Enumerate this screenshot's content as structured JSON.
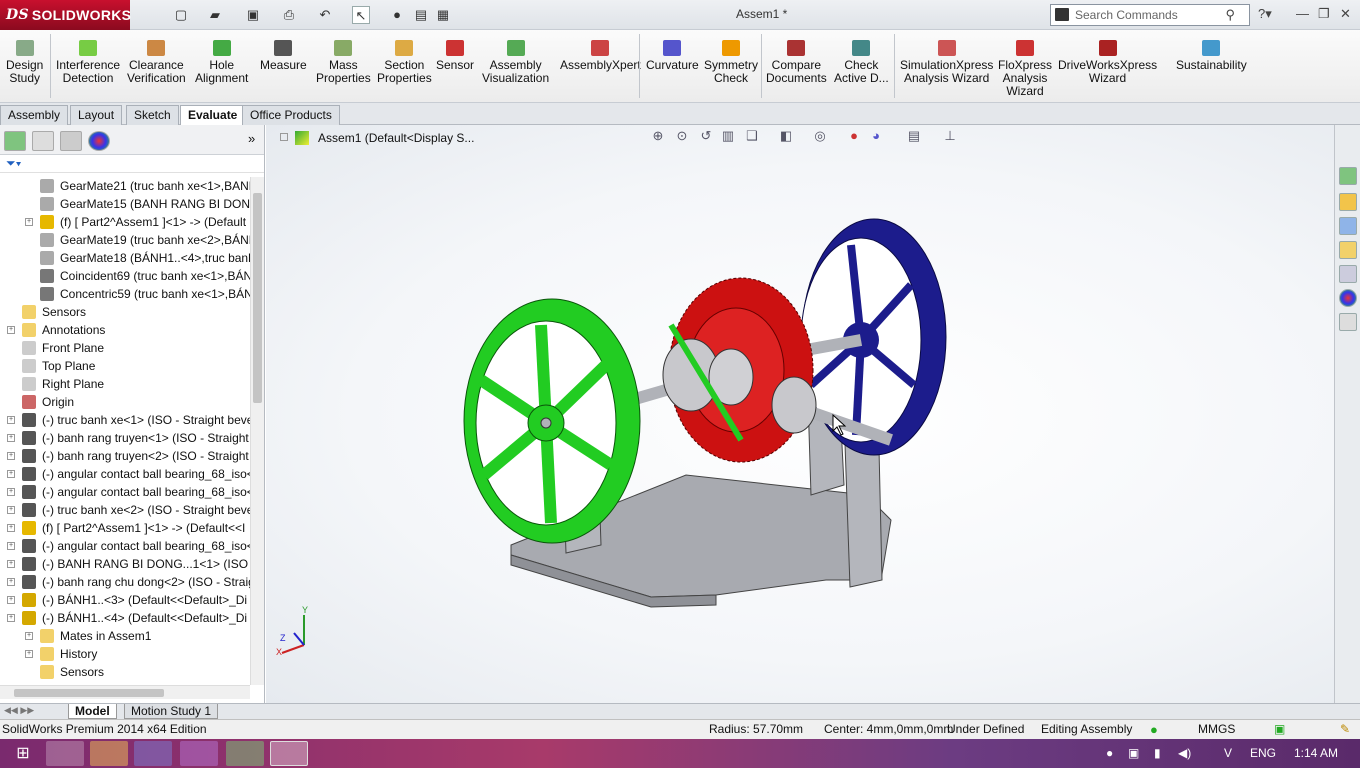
{
  "app": {
    "logo_text": "SOLIDWORKS",
    "window_title": "Assem1 *"
  },
  "search": {
    "placeholder": "Search Commands"
  },
  "ribbon": {
    "buttons": [
      {
        "label": "Design\nStudy",
        "icon": "design-study-icon"
      },
      {
        "label": "Interference\nDetection",
        "icon": "interference-icon"
      },
      {
        "label": "Clearance\nVerification",
        "icon": "clearance-icon"
      },
      {
        "label": "Hole\nAlignment",
        "icon": "hole-alignment-icon"
      },
      {
        "label": "Measure",
        "icon": "measure-icon"
      },
      {
        "label": "Mass\nProperties",
        "icon": "mass-properties-icon"
      },
      {
        "label": "Section\nProperties",
        "icon": "section-properties-icon"
      },
      {
        "label": "Sensor",
        "icon": "sensor-icon"
      },
      {
        "label": "Assembly\nVisualization",
        "icon": "assembly-visualization-icon"
      },
      {
        "label": "AssemblyXpert",
        "icon": "assemblyxpert-icon"
      },
      {
        "label": "Curvature",
        "icon": "curvature-icon"
      },
      {
        "label": "Symmetry\nCheck",
        "icon": "symmetry-icon"
      },
      {
        "label": "Compare\nDocuments",
        "icon": "compare-icon"
      },
      {
        "label": "Check\nActive D...",
        "icon": "check-active-icon"
      },
      {
        "label": "SimulationXpress\nAnalysis Wizard",
        "icon": "simulationxpress-icon"
      },
      {
        "label": "FloXpress\nAnalysis\nWizard",
        "icon": "floxpress-icon"
      },
      {
        "label": "DriveWorksXpress\nWizard",
        "icon": "driveworks-icon"
      },
      {
        "label": "Sustainability",
        "icon": "sustainability-icon"
      }
    ]
  },
  "tabs": [
    "Assembly",
    "Layout",
    "Sketch",
    "Evaluate",
    "Office Products"
  ],
  "active_tab": "Evaluate",
  "tree": {
    "items": [
      {
        "label": "GearMate21 (truc banh xe<1>,BANH",
        "indent": 2,
        "icon": "gear-mate-icon"
      },
      {
        "label": "GearMate15 (BANH RANG BI DONG",
        "indent": 2,
        "icon": "gear-mate-icon"
      },
      {
        "label": "(f) [ Part2^Assem1 ]<1> -> (Default",
        "indent": 2,
        "icon": "part-icon",
        "expand": true
      },
      {
        "label": "GearMate19 (truc banh xe<2>,BÁNH",
        "indent": 2,
        "icon": "gear-mate-icon"
      },
      {
        "label": "GearMate18 (BÁNH1..<4>,truc banh",
        "indent": 2,
        "icon": "gear-mate-icon"
      },
      {
        "label": "Coincident69 (truc banh xe<1>,BÁN",
        "indent": 2,
        "icon": "coincident-icon"
      },
      {
        "label": "Concentric59 (truc banh xe<1>,BÁN",
        "indent": 2,
        "icon": "concentric-icon"
      },
      {
        "label": "Sensors",
        "indent": 1,
        "icon": "sensors-icon"
      },
      {
        "label": "Annotations",
        "indent": 1,
        "icon": "annotations-icon",
        "expand": true
      },
      {
        "label": "Front Plane",
        "indent": 1,
        "icon": "plane-icon"
      },
      {
        "label": "Top Plane",
        "indent": 1,
        "icon": "plane-icon"
      },
      {
        "label": "Right Plane",
        "indent": 1,
        "icon": "plane-icon"
      },
      {
        "label": "Origin",
        "indent": 1,
        "icon": "origin-icon"
      },
      {
        "label": "(-) truc banh xe<1> (ISO - Straight beve",
        "indent": 1,
        "icon": "toolbox-part-icon",
        "expand": true
      },
      {
        "label": "(-) banh rang truyen<1> (ISO - Straight",
        "indent": 1,
        "icon": "toolbox-part-icon",
        "expand": true
      },
      {
        "label": "(-) banh rang truyen<2> (ISO - Straight",
        "indent": 1,
        "icon": "toolbox-part-icon",
        "expand": true
      },
      {
        "label": "(-) angular contact ball bearing_68_iso<",
        "indent": 1,
        "icon": "toolbox-part-icon",
        "expand": true
      },
      {
        "label": "(-) angular contact ball bearing_68_iso<",
        "indent": 1,
        "icon": "toolbox-part-icon",
        "expand": true
      },
      {
        "label": "(-) truc banh xe<2> (ISO - Straight beve",
        "indent": 1,
        "icon": "toolbox-part-icon",
        "expand": true
      },
      {
        "label": "(f) [ Part2^Assem1 ]<1> -> (Default<<I",
        "indent": 1,
        "icon": "part-icon",
        "expand": true
      },
      {
        "label": "(-) angular contact ball bearing_68_iso<",
        "indent": 1,
        "icon": "toolbox-part-icon",
        "expand": true
      },
      {
        "label": "(-) BANH RANG BI DONG...1<1> (ISO -",
        "indent": 1,
        "icon": "toolbox-part-icon",
        "expand": true
      },
      {
        "label": "(-) banh rang chu dong<2> (ISO - Straig",
        "indent": 1,
        "icon": "toolbox-part-icon",
        "expand": true
      },
      {
        "label": "(-) BÁNH1..<3> (Default<<Default>_Di",
        "indent": 1,
        "icon": "subassembly-icon",
        "expand": true
      },
      {
        "label": "(-) BÁNH1..<4> (Default<<Default>_Di",
        "indent": 1,
        "icon": "subassembly-icon",
        "expand": true
      },
      {
        "label": "Mates in Assem1",
        "indent": 2,
        "icon": "mates-folder-icon",
        "expand": true
      },
      {
        "label": "History",
        "indent": 2,
        "icon": "history-icon",
        "expand": true
      },
      {
        "label": "Sensors",
        "indent": 2,
        "icon": "sensors-icon"
      }
    ]
  },
  "viewport": {
    "assembly_title": "Assem1  (Default<Display S..."
  },
  "bottom_tabs": [
    "Model",
    "Motion Study 1"
  ],
  "status": {
    "edition": "SolidWorks Premium 2014 x64 Edition",
    "radius": "Radius: 57.70mm",
    "center": "Center: 4mm,0mm,0mm",
    "state": "Under Defined",
    "mode": "Editing Assembly",
    "units": "MMGS"
  },
  "taskbar": {
    "lang": "ENG",
    "time": "1:14 AM"
  },
  "colors": {
    "brand": "#c8102e",
    "wheel_left": "#22cc22",
    "wheel_right": "#1c1c8c",
    "gears": "#cc1111",
    "base": "#a8aab0"
  }
}
